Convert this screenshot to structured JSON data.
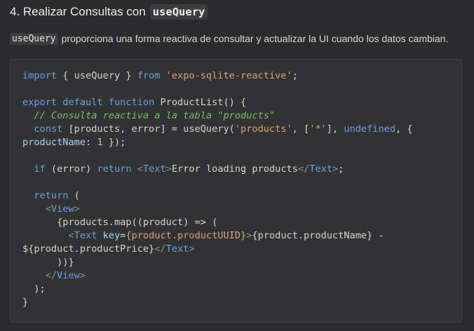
{
  "section": {
    "heading_text": "4. Realizar Consultas con",
    "heading_code": "useQuery",
    "intro_code": "useQuery",
    "intro_text": "proporciona una forma reactiva de consultar y actualizar la UI cuando los datos cambian."
  },
  "code": {
    "lines": [
      [
        [
          "keyword",
          "import"
        ],
        [
          "plain",
          " { useQuery } "
        ],
        [
          "keyword",
          "from"
        ],
        [
          "plain",
          " "
        ],
        [
          "string",
          "'expo-sqlite-reactive'"
        ],
        [
          "plain",
          ";"
        ]
      ],
      [],
      [
        [
          "keyword",
          "export"
        ],
        [
          "plain",
          " "
        ],
        [
          "keyword",
          "default"
        ],
        [
          "plain",
          " "
        ],
        [
          "keyword",
          "function"
        ],
        [
          "plain",
          " ProductList() {"
        ]
      ],
      [
        [
          "plain",
          "  "
        ],
        [
          "comment",
          "// Consulta reactiva a la tabla \"products\""
        ]
      ],
      [
        [
          "plain",
          "  "
        ],
        [
          "keyword",
          "const"
        ],
        [
          "plain",
          " [products, error] = useQuery("
        ],
        [
          "string",
          "'products'"
        ],
        [
          "plain",
          ", ["
        ],
        [
          "string",
          "'*'"
        ],
        [
          "plain",
          "], "
        ],
        [
          "keyword",
          "undefined"
        ],
        [
          "plain",
          ", {"
        ]
      ],
      [
        [
          "prop",
          "productName"
        ],
        [
          "plain",
          ": "
        ],
        [
          "number",
          "1"
        ],
        [
          "plain",
          " });"
        ]
      ],
      [],
      [
        [
          "plain",
          "  "
        ],
        [
          "keyword",
          "if"
        ],
        [
          "plain",
          " (error) "
        ],
        [
          "keyword",
          "return"
        ],
        [
          "plain",
          " "
        ],
        [
          "bracket",
          "<"
        ],
        [
          "tag",
          "Text"
        ],
        [
          "bracket",
          ">"
        ],
        [
          "plain",
          "Error loading products"
        ],
        [
          "bracket",
          "</"
        ],
        [
          "tag",
          "Text"
        ],
        [
          "bracket",
          ">"
        ],
        [
          "plain",
          ";"
        ]
      ],
      [],
      [
        [
          "plain",
          "  "
        ],
        [
          "keyword",
          "return"
        ],
        [
          "plain",
          " ("
        ]
      ],
      [
        [
          "plain",
          "    "
        ],
        [
          "bracket",
          "<"
        ],
        [
          "tag",
          "View"
        ],
        [
          "bracket",
          ">"
        ]
      ],
      [
        [
          "plain",
          "      {products.map((product) => ("
        ]
      ],
      [
        [
          "plain",
          "        "
        ],
        [
          "bracket",
          "<"
        ],
        [
          "tag",
          "Text"
        ],
        [
          "plain",
          " "
        ],
        [
          "attr",
          "key"
        ],
        [
          "plain",
          "="
        ],
        [
          "expr",
          "{product.productUUID}"
        ],
        [
          "bracket",
          ">"
        ],
        [
          "plain",
          "{product.productName} -"
        ]
      ],
      [
        [
          "plain",
          "${product.productPrice}"
        ],
        [
          "bracket",
          "</"
        ],
        [
          "tag",
          "Text"
        ],
        [
          "bracket",
          ">"
        ]
      ],
      [
        [
          "plain",
          "      ))}"
        ]
      ],
      [
        [
          "plain",
          "    "
        ],
        [
          "bracket",
          "</"
        ],
        [
          "tag",
          "View"
        ],
        [
          "bracket",
          ">"
        ]
      ],
      [
        [
          "plain",
          "  );"
        ]
      ],
      [
        [
          "plain",
          "}"
        ]
      ]
    ]
  }
}
